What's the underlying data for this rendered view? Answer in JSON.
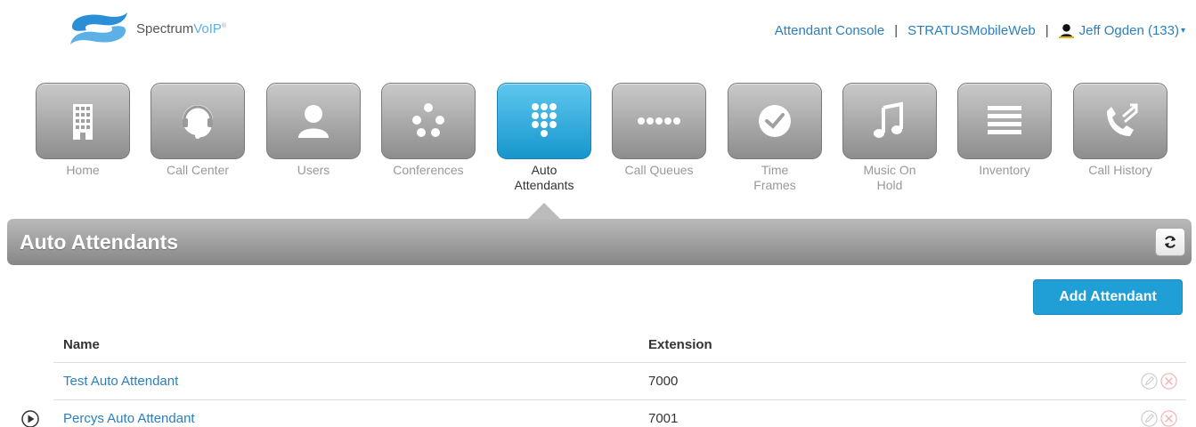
{
  "brand": {
    "name_part1": "Spectrum",
    "name_part2": "VoIP",
    "mark": "®"
  },
  "topnav": {
    "attendant_console": "Attendant Console",
    "sep1": "|",
    "stratus": "STRATUSMobileWeb",
    "sep2": "|",
    "user": "Jeff Ogden (133)",
    "caret": "▾"
  },
  "tabs": [
    {
      "label": "Home",
      "icon": "building-icon",
      "active": false
    },
    {
      "label": "Call Center",
      "icon": "headset-icon",
      "active": false
    },
    {
      "label": "Users",
      "icon": "user-icon",
      "active": false
    },
    {
      "label": "Conferences",
      "icon": "conference-icon",
      "active": false
    },
    {
      "label": "Auto\nAttendants",
      "icon": "keypad-icon",
      "active": true
    },
    {
      "label": "Call Queues",
      "icon": "queue-icon",
      "active": false
    },
    {
      "label": "Time\nFrames",
      "icon": "clock-icon",
      "active": false
    },
    {
      "label": "Music On\nHold",
      "icon": "music-note-icon",
      "active": false
    },
    {
      "label": "Inventory",
      "icon": "list-icon",
      "active": false
    },
    {
      "label": "Call History",
      "icon": "phone-history-icon",
      "active": false
    }
  ],
  "section": {
    "title": "Auto Attendants",
    "refresh_icon": "refresh-icon"
  },
  "add_button": "Add Attendant",
  "table": {
    "columns": {
      "name": "Name",
      "extension": "Extension"
    },
    "rows": [
      {
        "name": "Test Auto Attendant",
        "extension": "7000",
        "has_play": false
      },
      {
        "name": "Percys Auto Attendant",
        "extension": "7001",
        "has_play": true
      }
    ]
  },
  "colors": {
    "accent": "#1f9fd6",
    "link": "#2a7fc1",
    "tile_gray": "#a9a9a9",
    "tile_active": "#1696cc"
  }
}
